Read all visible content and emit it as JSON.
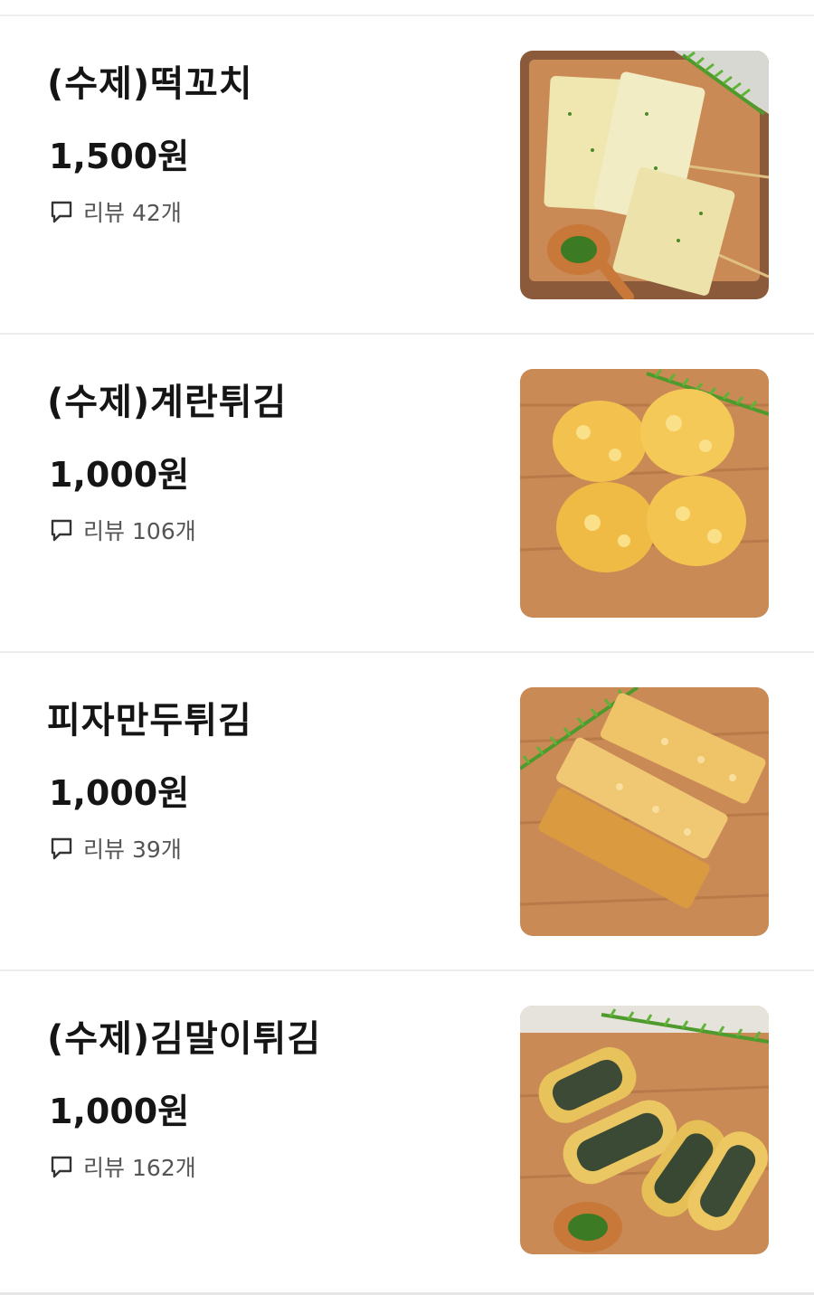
{
  "review_label": "리뷰",
  "colors": {
    "text_primary": "#151515",
    "text_secondary": "#555555",
    "divider": "#ececec"
  },
  "menu_items": [
    {
      "name": "(수제)떡꼬치",
      "price": "1,500원",
      "review_count": "42개",
      "image": "rice-cake-skewer-photo"
    },
    {
      "name": "(수제)계란튀김",
      "price": "1,000원",
      "review_count": "106개",
      "image": "fried-egg-tempura-photo"
    },
    {
      "name": "피자만두튀김",
      "price": "1,000원",
      "review_count": "39개",
      "image": "pizza-dumpling-tempura-photo"
    },
    {
      "name": "(수제)김말이튀김",
      "price": "1,000원",
      "review_count": "162개",
      "image": "seaweed-roll-tempura-photo"
    }
  ]
}
